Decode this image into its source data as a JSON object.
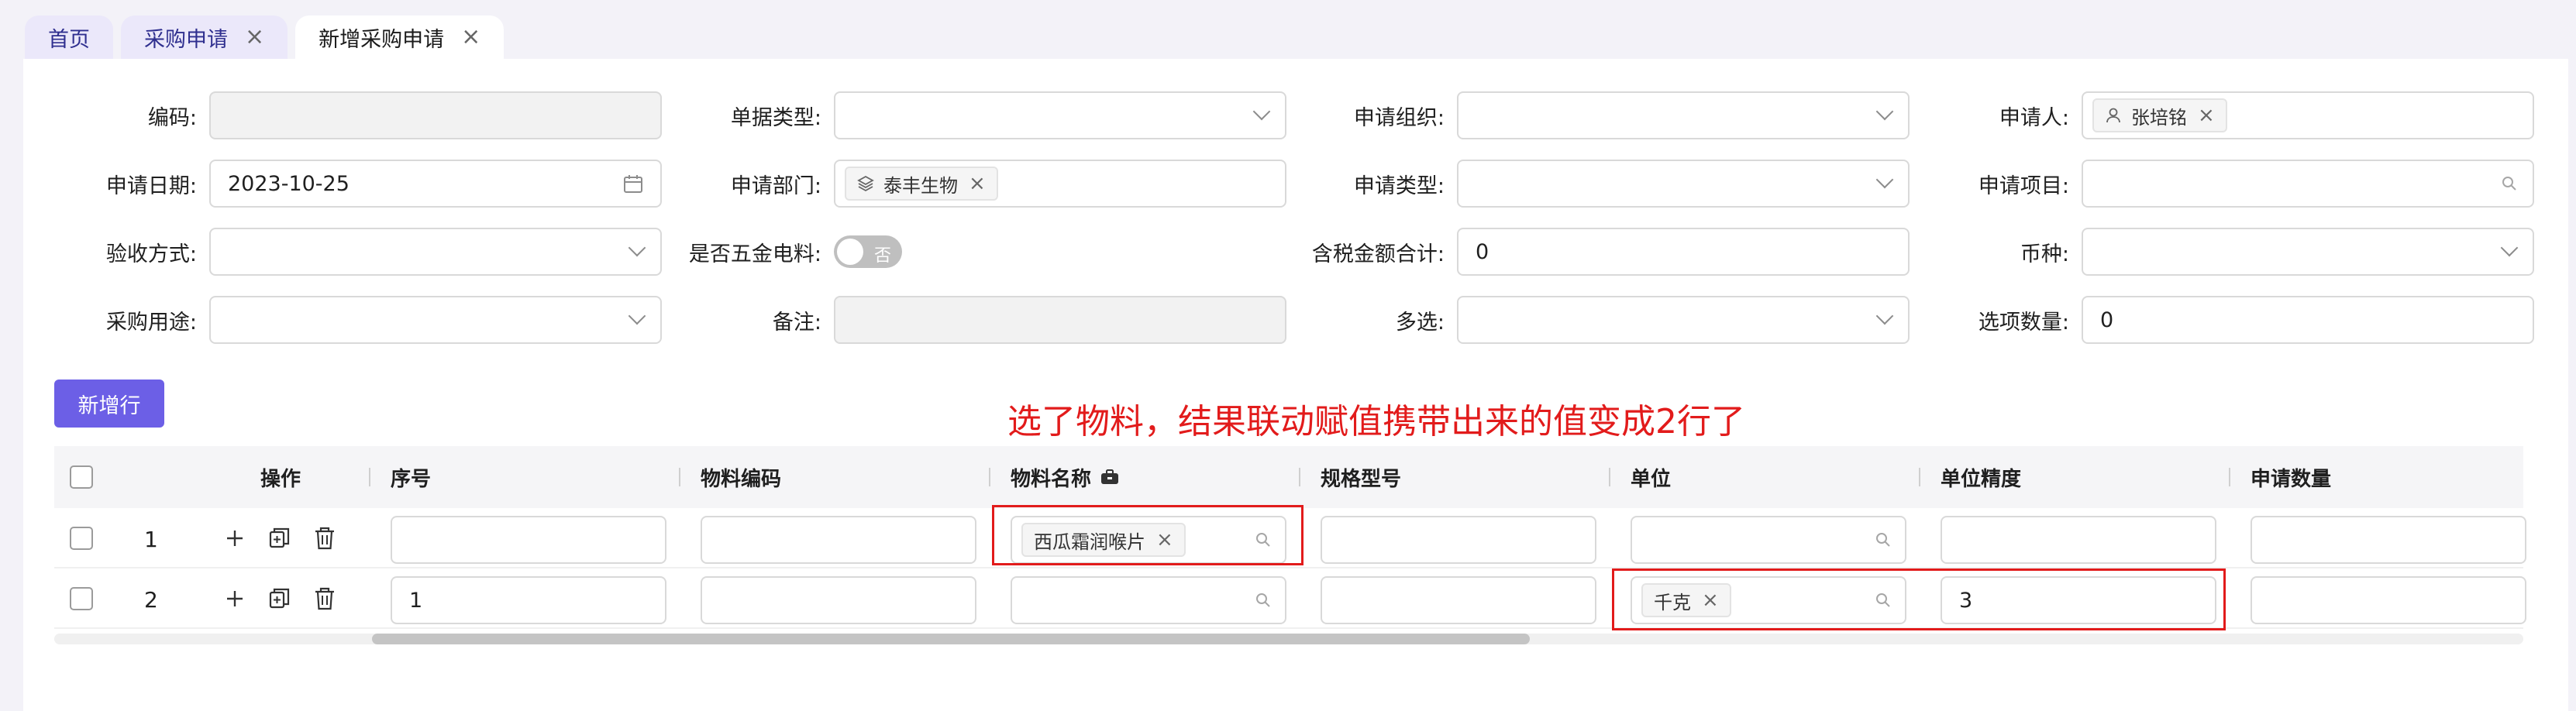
{
  "tabs": [
    {
      "label": "首页",
      "closable": false
    },
    {
      "label": "采购申请",
      "closable": true
    },
    {
      "label": "新增采购申请",
      "closable": true,
      "active": true
    }
  ],
  "form": {
    "code": {
      "label": "编码:",
      "value": ""
    },
    "doc_type": {
      "label": "单据类型:",
      "value": ""
    },
    "apply_org": {
      "label": "申请组织:",
      "value": ""
    },
    "applicant": {
      "label": "申请人:",
      "tag": "张培铭"
    },
    "apply_date": {
      "label": "申请日期:",
      "value": "2023-10-25"
    },
    "apply_dept": {
      "label": "申请部门:",
      "tag": "泰丰生物"
    },
    "apply_type": {
      "label": "申请类型:",
      "value": ""
    },
    "apply_project": {
      "label": "申请项目:",
      "value": ""
    },
    "accept_method": {
      "label": "验收方式:",
      "value": ""
    },
    "is_hardware": {
      "label": "是否五金电料:",
      "switch_text": "否"
    },
    "tax_total": {
      "label": "含税金额合计:",
      "value": "0"
    },
    "currency": {
      "label": "币种:",
      "value": ""
    },
    "purpose": {
      "label": "采购用途:",
      "value": ""
    },
    "remark": {
      "label": "备注:",
      "value": ""
    },
    "multi": {
      "label": "多选:",
      "value": ""
    },
    "option_count": {
      "label": "选项数量:",
      "value": "0"
    }
  },
  "add_row_label": "新增行",
  "annotation": "选了物料，结果联动赋值携带出来的值变成2行了",
  "table": {
    "columns": {
      "action": "操作",
      "seq": "序号",
      "material_code": "物料编码",
      "material_name": "物料名称",
      "spec": "规格型号",
      "unit": "单位",
      "unit_precision": "单位精度",
      "quantity": "申请数量"
    },
    "rows": [
      {
        "index": "1",
        "seq": "",
        "material_code": "",
        "material_name_tag": "西瓜霜润喉片",
        "spec": "",
        "unit_tag": "",
        "unit_precision": "",
        "quantity": ""
      },
      {
        "index": "2",
        "seq": "1",
        "material_code": "",
        "material_name_tag": "",
        "spec": "",
        "unit_tag": "千克",
        "unit_precision": "3",
        "quantity": ""
      }
    ]
  },
  "colors": {
    "primary": "#6c5fe6",
    "annotation": "#e21b1b"
  }
}
